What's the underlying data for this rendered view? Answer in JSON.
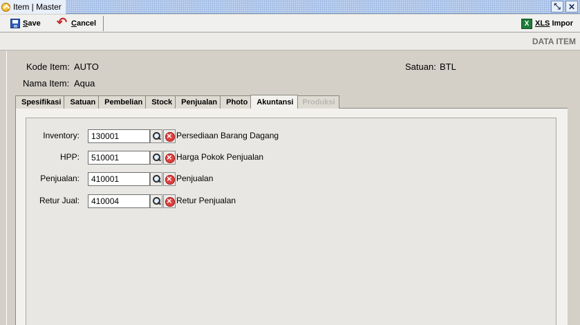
{
  "window": {
    "title": "Item | Master"
  },
  "toolbar": {
    "save_label": "Save",
    "save_underline": "S",
    "save_rest": "ave",
    "cancel_underline": "C",
    "cancel_rest": "ancel",
    "xls_underline": "XLS",
    "xls_rest": " Impor",
    "xls_icon_text": "X"
  },
  "header": {
    "section_title": "DATA ITEM"
  },
  "item": {
    "kode_label": "Kode Item:",
    "kode_value": "AUTO",
    "nama_label": "Nama Item:",
    "nama_value": "Aqua",
    "satuan_label": "Satuan:",
    "satuan_value": "BTL"
  },
  "tabs": [
    {
      "label": "Spesifikasi",
      "state": "normal"
    },
    {
      "label": "Satuan",
      "state": "normal"
    },
    {
      "label": "Pembelian",
      "state": "normal"
    },
    {
      "label": "Stock",
      "state": "normal"
    },
    {
      "label": "Penjualan",
      "state": "normal"
    },
    {
      "label": "Photo",
      "state": "normal"
    },
    {
      "label": "Akuntansi",
      "state": "active"
    },
    {
      "label": "Produksi",
      "state": "disabled"
    }
  ],
  "accounts": [
    {
      "label": "Inventory:",
      "code": "130001",
      "description": "Persediaan Barang Dagang"
    },
    {
      "label": "HPP:",
      "code": "510001",
      "description": "Harga Pokok Penjualan"
    },
    {
      "label": "Penjualan:",
      "code": "410001",
      "description": "Penjualan"
    },
    {
      "label": "Retur Jual:",
      "code": "410004",
      "description": "Retur Penjualan"
    }
  ],
  "icons": {
    "title": "app-icon",
    "minimize": "restore-icon",
    "close": "close-icon",
    "save": "save-icon",
    "cancel": "undo-icon",
    "xls": "excel-icon",
    "search": "search-icon",
    "clear": "clear-icon"
  }
}
